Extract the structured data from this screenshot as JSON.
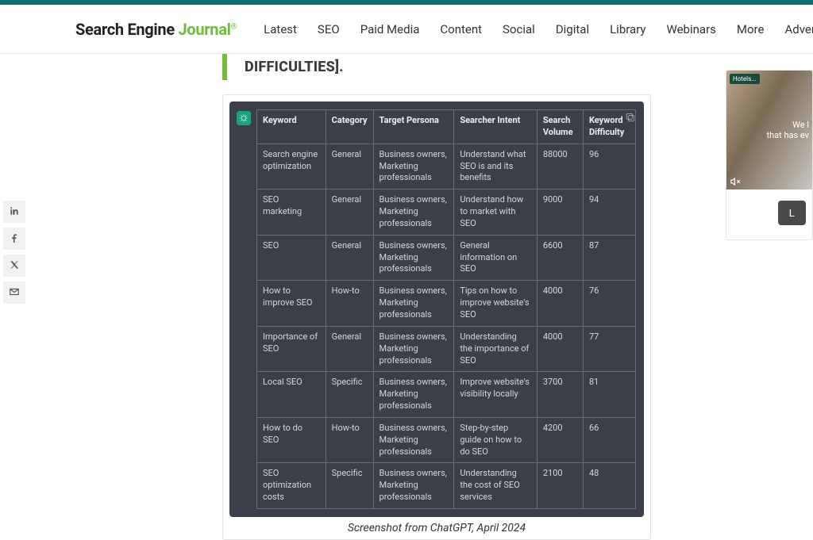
{
  "header": {
    "logo_part1": "Search Engine ",
    "logo_part2": "Journal",
    "logo_reg": "®",
    "nav": [
      "Latest",
      "SEO",
      "Paid Media",
      "Content",
      "Social",
      "Digital",
      "Library",
      "Webinars",
      "More",
      "Advertise"
    ]
  },
  "quote_fragment": "DIFFICULTIES].",
  "figure_caption": "Screenshot from ChatGPT, April 2024",
  "ad": {
    "brand": "Hotels...",
    "line1": "We l",
    "line2": "that has ev",
    "cta": "L"
  },
  "chart_data": {
    "type": "table",
    "title": "",
    "columns": [
      "Keyword",
      "Category",
      "Target Persona",
      "Searcher Intent",
      "Search Volume",
      "Keyword Difficulty"
    ],
    "rows": [
      {
        "keyword": "Search engine optimization",
        "category": "General",
        "persona": "Business owners, Marketing professionals",
        "intent": "Understand what SEO is and its benefits",
        "volume": "88000",
        "difficulty": "96"
      },
      {
        "keyword": "SEO marketing",
        "category": "General",
        "persona": "Business owners, Marketing professionals",
        "intent": "Understand how to market with SEO",
        "volume": "9000",
        "difficulty": "94"
      },
      {
        "keyword": "SEO",
        "category": "General",
        "persona": "Business owners, Marketing professionals",
        "intent": "General information on SEO",
        "volume": "6600",
        "difficulty": "87"
      },
      {
        "keyword": "How to improve SEO",
        "category": "How-to",
        "persona": "Business owners, Marketing professionals",
        "intent": "Tips on how to improve website's SEO",
        "volume": "4000",
        "difficulty": "76"
      },
      {
        "keyword": "Importance of SEO",
        "category": "General",
        "persona": "Business owners, Marketing professionals",
        "intent": "Understanding the importance of SEO",
        "volume": "4000",
        "difficulty": "77"
      },
      {
        "keyword": "Local SEO",
        "category": "Specific",
        "persona": "Business owners, Marketing professionals",
        "intent": "Improve website's visibility locally",
        "volume": "3700",
        "difficulty": "81"
      },
      {
        "keyword": "How to do SEO",
        "category": "How-to",
        "persona": "Business owners, Marketing professionals",
        "intent": "Step-by-step guide on how to do SEO",
        "volume": "4200",
        "difficulty": "66"
      },
      {
        "keyword": "SEO optimization costs",
        "category": "Specific",
        "persona": "Business owners, Marketing professionals",
        "intent": "Understanding the cost of SEO services",
        "volume": "2100",
        "difficulty": "48"
      }
    ]
  }
}
